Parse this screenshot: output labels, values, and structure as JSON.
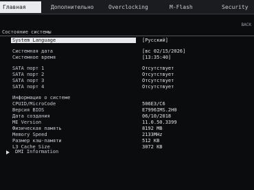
{
  "tabs": [
    "Главная",
    "Дополнительно",
    "Overclocking",
    "M-Flash",
    "Security"
  ],
  "back_label": "BACK",
  "section_title": "Состояние системы",
  "language": {
    "label": "System Language",
    "value": "[Русский]"
  },
  "date": {
    "label": "Системная дата",
    "value": "[вс 02/15/2026]"
  },
  "time": {
    "label": "Системное время",
    "value": "[13:35:40]"
  },
  "sata": [
    {
      "label": "SATA порт 1",
      "value": "Отсутствует"
    },
    {
      "label": "SATA порт 2",
      "value": "Отсутствует"
    },
    {
      "label": "SATA порт 3",
      "value": "Отсутствует"
    },
    {
      "label": "SATA порт 4",
      "value": "Отсутствует"
    }
  ],
  "sysinfo_header": "Информация о системе",
  "sysinfo": [
    {
      "label": "CPUID/MicroCode",
      "value": "506E3/C6"
    },
    {
      "label": "Версия BIOS",
      "value": "E7996IMS.2H0"
    },
    {
      "label": "Дата создания",
      "value": "06/10/2018"
    },
    {
      "label": "ME Version",
      "value": "11.0.50.3399"
    },
    {
      "label": "Физическая память",
      "value": "8192 MB"
    },
    {
      "label": "Memory Speed",
      "value": "2133MHz"
    },
    {
      "label": "Размер кэш-памяти",
      "value": "512 KB"
    },
    {
      "label": "L3 Cache Size",
      "value": "3072 KB"
    }
  ],
  "dmi_label": "DMI Information",
  "icons": {
    "dmi": "triangle-right-icon"
  }
}
